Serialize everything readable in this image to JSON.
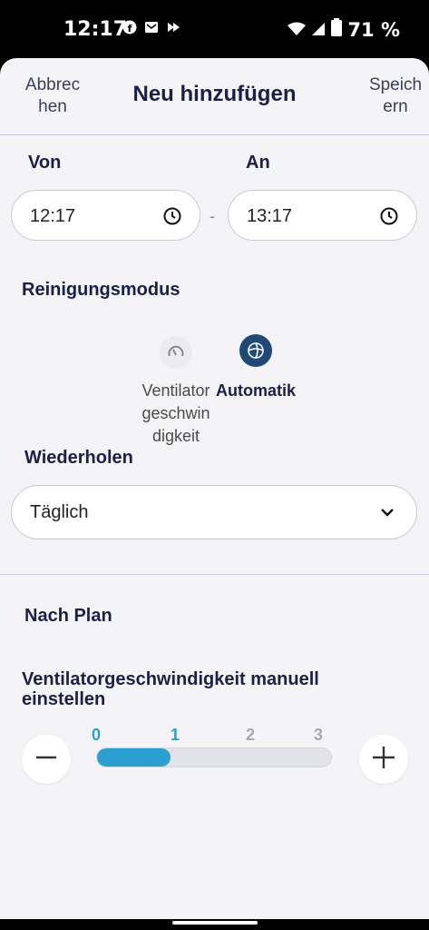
{
  "status_bar": {
    "time": "12:17",
    "battery_percent": "71 %"
  },
  "header": {
    "cancel": "Abbrec hen",
    "title": "Neu hinzufügen",
    "save": "Speich ern"
  },
  "time_range": {
    "from_label": "Von",
    "from_value": "12:17",
    "to_label": "An",
    "to_value": "13:17",
    "separator": "-"
  },
  "cleaning_mode": {
    "label": "Reinigungsmodus",
    "options": [
      {
        "label": "Ventilatorgeschwindigkeit",
        "icon": "gauge-icon",
        "selected": false
      },
      {
        "label": "Automatik",
        "icon": "auto-swirl-icon",
        "selected": true
      }
    ]
  },
  "repeat": {
    "label": "Wiederholen",
    "value": "Täglich"
  },
  "schedule": {
    "label": "Nach Plan"
  },
  "fan_speed": {
    "label": "Ventilatorgeschwindigkeit manuell einstellen",
    "ticks": [
      "0",
      "1",
      "2",
      "3"
    ],
    "level": 1,
    "max": 3
  },
  "colors": {
    "accent": "#2a9fd0",
    "navy": "#1b1f4a",
    "selected_mode_bg": "#1f4a78"
  }
}
